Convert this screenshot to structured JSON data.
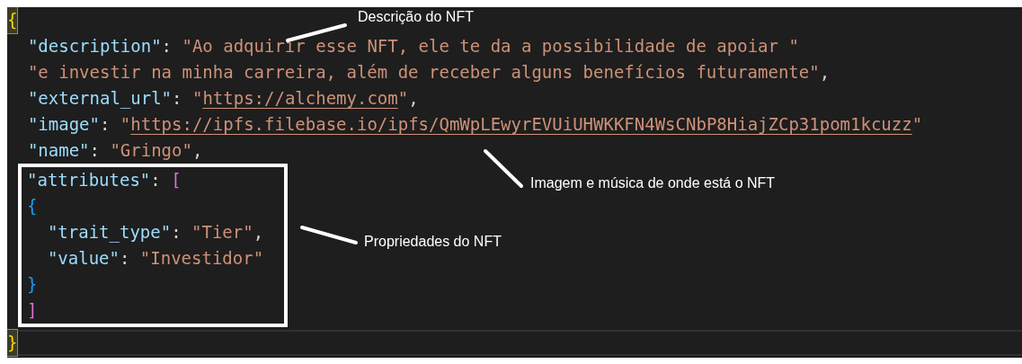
{
  "editor": {
    "lines_before": [
      {
        "current": false,
        "tokens": [
          {
            "kind": "brace-matched",
            "text": "{"
          }
        ]
      },
      {
        "current": false,
        "tokens": [
          {
            "kind": "key",
            "text": "  \"description\""
          },
          {
            "kind": "punct",
            "text": ": "
          },
          {
            "kind": "string",
            "text": "\"Ao adquirir esse NFT, ele te da a possibilidade de apoiar \""
          }
        ]
      },
      {
        "current": false,
        "tokens": [
          {
            "kind": "string",
            "text": "  \"e investir na minha carreira, além de receber alguns benefícios futuramente\""
          },
          {
            "kind": "punct",
            "text": ","
          }
        ]
      },
      {
        "current": false,
        "tokens": [
          {
            "kind": "key",
            "text": "  \"external_url\""
          },
          {
            "kind": "punct",
            "text": ": "
          },
          {
            "kind": "string",
            "text": "\""
          },
          {
            "kind": "link",
            "text": "https://alchemy.com"
          },
          {
            "kind": "string",
            "text": "\""
          },
          {
            "kind": "punct",
            "text": ","
          }
        ]
      },
      {
        "current": false,
        "tokens": [
          {
            "kind": "key",
            "text": "  \"image\""
          },
          {
            "kind": "punct",
            "text": ": "
          },
          {
            "kind": "string",
            "text": "\""
          },
          {
            "kind": "link",
            "text": "https://ipfs.filebase.io/ipfs/QmWpLEwyrEVUiUHWKKFN4WsCNbP8HiajZCp31pom1kcuzz"
          },
          {
            "kind": "string",
            "text": "\""
          }
        ]
      },
      {
        "current": false,
        "tokens": [
          {
            "kind": "key",
            "text": "  \"name\""
          },
          {
            "kind": "punct",
            "text": ": "
          },
          {
            "kind": "string",
            "text": "\"Gringo\""
          },
          {
            "kind": "punct",
            "text": ","
          }
        ]
      }
    ],
    "lines_boxed": [
      {
        "current": false,
        "tokens": [
          {
            "kind": "key",
            "text": "\"attributes\""
          },
          {
            "kind": "punct",
            "text": ": "
          },
          {
            "kind": "bracket",
            "text": "["
          }
        ]
      },
      {
        "current": false,
        "tokens": [
          {
            "kind": "brace-inner",
            "text": "{"
          }
        ]
      },
      {
        "current": false,
        "tokens": [
          {
            "kind": "key",
            "text": "  \"trait_type\""
          },
          {
            "kind": "punct",
            "text": ": "
          },
          {
            "kind": "string",
            "text": "\"Tier\""
          },
          {
            "kind": "punct",
            "text": ","
          }
        ]
      },
      {
        "current": false,
        "tokens": [
          {
            "kind": "key",
            "text": "  \"value\""
          },
          {
            "kind": "punct",
            "text": ": "
          },
          {
            "kind": "string",
            "text": "\"Investidor\""
          }
        ]
      },
      {
        "current": false,
        "tokens": [
          {
            "kind": "brace-inner",
            "text": "}"
          }
        ]
      },
      {
        "current": false,
        "tokens": [
          {
            "kind": "bracket",
            "text": "]"
          }
        ]
      }
    ],
    "lines_after": [
      {
        "current": true,
        "tokens": [
          {
            "kind": "brace-matched",
            "text": "}"
          }
        ]
      }
    ]
  },
  "annotations": [
    {
      "kind": "description",
      "text": "Descrição do NFT"
    },
    {
      "kind": "image",
      "text": "Imagem e música de onde está o NFT"
    },
    {
      "kind": "attributes",
      "text": "Propriedades do NFT"
    }
  ]
}
